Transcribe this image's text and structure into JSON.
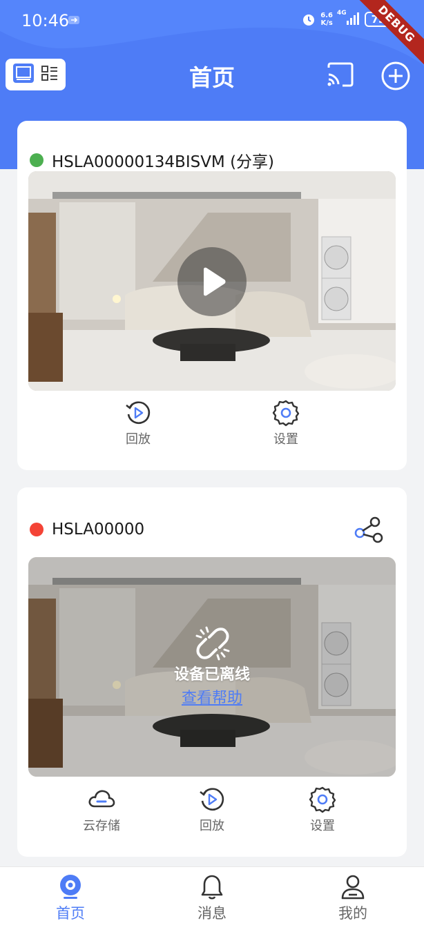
{
  "status_bar": {
    "time": "10:46",
    "net_speed_value": "6.6",
    "net_speed_unit": "K/s",
    "network_type": "4G",
    "battery": "73",
    "debug_label": "DEBUG"
  },
  "header": {
    "title": "首页"
  },
  "devices": [
    {
      "name": "HSLA00000134BISVM (分享)",
      "status": "online",
      "status_color": "#4caf50",
      "actions": [
        {
          "label": "回放",
          "icon": "playback-icon"
        },
        {
          "label": "设置",
          "icon": "gear-icon"
        }
      ]
    },
    {
      "name": "HSLA00000",
      "status": "offline",
      "status_color": "#f44336",
      "offline_text": "设备已离线",
      "help_link": "查看帮助",
      "actions": [
        {
          "label": "云存储",
          "icon": "cloud-storage-icon"
        },
        {
          "label": "回放",
          "icon": "playback-icon"
        },
        {
          "label": "设置",
          "icon": "gear-icon"
        }
      ]
    }
  ],
  "bottom_nav": {
    "items": [
      {
        "label": "首页",
        "icon": "camera-icon",
        "active": true
      },
      {
        "label": "消息",
        "icon": "bell-icon",
        "active": false
      },
      {
        "label": "我的",
        "icon": "user-icon",
        "active": false
      }
    ]
  },
  "colors": {
    "accent": "#4e7cf6",
    "online": "#4caf50",
    "offline": "#f44336"
  }
}
